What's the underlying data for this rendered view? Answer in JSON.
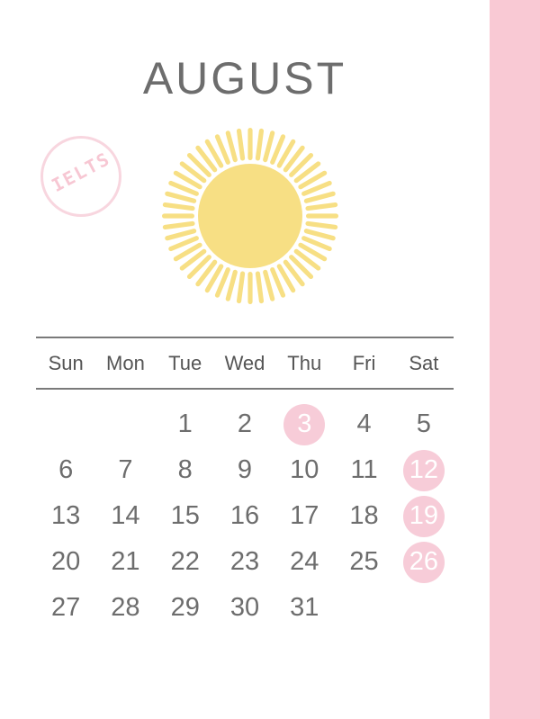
{
  "page": {
    "background_color": "#ffffff",
    "accent_pink": "#f9c9d4",
    "highlight_pink": "#f7ccd8",
    "sun_yellow": "#f7df84",
    "text_gray": "#6d6d6d"
  },
  "header": {
    "month_title": "AUGUST"
  },
  "stamp": {
    "text": "IELTS",
    "color": "#f7c7d3"
  },
  "decoration": {
    "sun_label": "sun-illustration",
    "ray_count": 48
  },
  "calendar": {
    "weekdays": [
      "Sun",
      "Mon",
      "Tue",
      "Wed",
      "Thu",
      "Fri",
      "Sat"
    ],
    "weeks": [
      [
        {
          "label": "",
          "empty": true,
          "highlight": false
        },
        {
          "label": "",
          "empty": true,
          "highlight": false
        },
        {
          "label": "1",
          "empty": false,
          "highlight": false
        },
        {
          "label": "2",
          "empty": false,
          "highlight": false
        },
        {
          "label": "3",
          "empty": false,
          "highlight": true
        },
        {
          "label": "4",
          "empty": false,
          "highlight": false
        },
        {
          "label": "5",
          "empty": false,
          "highlight": false
        }
      ],
      [
        {
          "label": "6",
          "empty": false,
          "highlight": false
        },
        {
          "label": "7",
          "empty": false,
          "highlight": false
        },
        {
          "label": "8",
          "empty": false,
          "highlight": false
        },
        {
          "label": "9",
          "empty": false,
          "highlight": false
        },
        {
          "label": "10",
          "empty": false,
          "highlight": false
        },
        {
          "label": "11",
          "empty": false,
          "highlight": false
        },
        {
          "label": "12",
          "empty": false,
          "highlight": true
        }
      ],
      [
        {
          "label": "13",
          "empty": false,
          "highlight": false
        },
        {
          "label": "14",
          "empty": false,
          "highlight": false
        },
        {
          "label": "15",
          "empty": false,
          "highlight": false
        },
        {
          "label": "16",
          "empty": false,
          "highlight": false
        },
        {
          "label": "17",
          "empty": false,
          "highlight": false
        },
        {
          "label": "18",
          "empty": false,
          "highlight": false
        },
        {
          "label": "19",
          "empty": false,
          "highlight": true
        }
      ],
      [
        {
          "label": "20",
          "empty": false,
          "highlight": false
        },
        {
          "label": "21",
          "empty": false,
          "highlight": false
        },
        {
          "label": "22",
          "empty": false,
          "highlight": false
        },
        {
          "label": "23",
          "empty": false,
          "highlight": false
        },
        {
          "label": "24",
          "empty": false,
          "highlight": false
        },
        {
          "label": "25",
          "empty": false,
          "highlight": false
        },
        {
          "label": "26",
          "empty": false,
          "highlight": true
        }
      ],
      [
        {
          "label": "27",
          "empty": false,
          "highlight": false
        },
        {
          "label": "28",
          "empty": false,
          "highlight": false
        },
        {
          "label": "29",
          "empty": false,
          "highlight": false
        },
        {
          "label": "30",
          "empty": false,
          "highlight": false
        },
        {
          "label": "31",
          "empty": false,
          "highlight": false
        },
        {
          "label": "",
          "empty": true,
          "highlight": false
        },
        {
          "label": "",
          "empty": true,
          "highlight": false
        }
      ]
    ]
  }
}
